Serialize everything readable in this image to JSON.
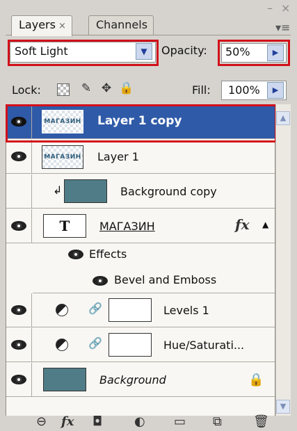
{
  "tabs": [
    {
      "label": "Layers",
      "close": "×",
      "active": true
    },
    {
      "label": "Channels",
      "active": false
    }
  ],
  "window_controls": {
    "minimize": "–",
    "close": "×",
    "menu": "▾≡"
  },
  "blend_mode": {
    "value": "Soft Light"
  },
  "opacity": {
    "label": "Opacity:",
    "value": "50%"
  },
  "lock": {
    "label": "Lock:"
  },
  "fill": {
    "label": "Fill:",
    "value": "100%"
  },
  "layers": [
    {
      "name": "Layer 1 copy",
      "thumb_text": "МАГАЗИН",
      "selected": true,
      "visible": true
    },
    {
      "name": "Layer 1",
      "thumb_text": "МАГАЗИН",
      "selected": false,
      "visible": true
    },
    {
      "name": "Background copy",
      "selected": false,
      "visible": false,
      "clipped": true
    },
    {
      "name": "МАГАЗИН",
      "thumb_text": "T",
      "type": "text",
      "visible": true,
      "fx": "fx"
    },
    {
      "name": "Effects",
      "type": "effects-group",
      "visible": true
    },
    {
      "name": "Bevel and Emboss",
      "type": "effect",
      "visible": true
    },
    {
      "name": "Levels 1",
      "type": "adjustment",
      "visible": true
    },
    {
      "name": "Hue/Saturati...",
      "type": "adjustment",
      "visible": true
    },
    {
      "name": "Background",
      "type": "background",
      "visible": true,
      "locked": true
    }
  ],
  "colors": {
    "selection": "#2f5aa8",
    "highlight_red": "#d2101a",
    "layer_teal": "#4f7c86"
  }
}
